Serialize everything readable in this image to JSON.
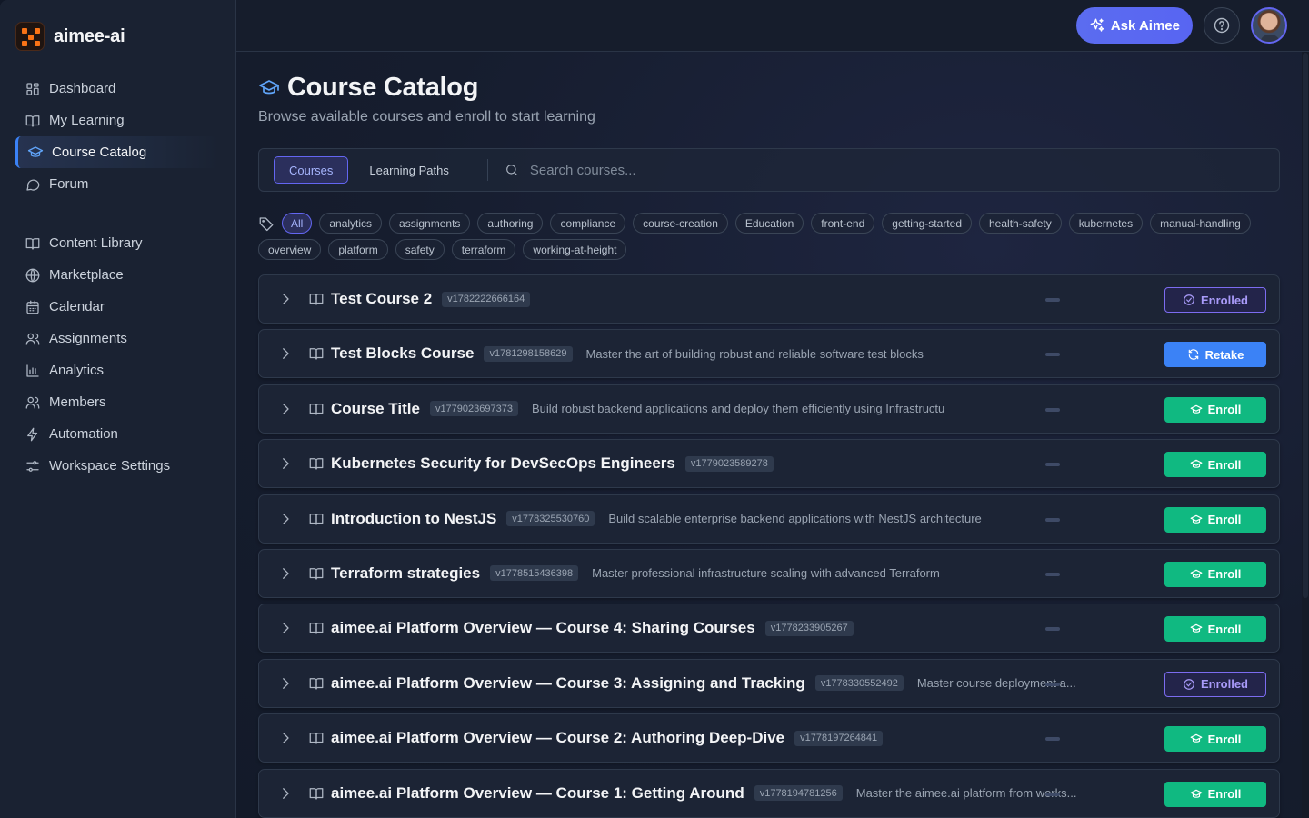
{
  "brand": {
    "name": "aimee-ai"
  },
  "nav_primary": [
    {
      "label": "Dashboard",
      "icon": "grid-icon"
    },
    {
      "label": "My Learning",
      "icon": "book-open-icon"
    },
    {
      "label": "Course Catalog",
      "icon": "graduation-cap-icon",
      "active": true
    },
    {
      "label": "Forum",
      "icon": "message-circle-icon"
    }
  ],
  "nav_secondary": [
    {
      "label": "Content Library",
      "icon": "book-open-icon"
    },
    {
      "label": "Marketplace",
      "icon": "globe-icon"
    },
    {
      "label": "Calendar",
      "icon": "calendar-icon"
    },
    {
      "label": "Assignments",
      "icon": "users-icon"
    },
    {
      "label": "Analytics",
      "icon": "bar-chart-icon"
    },
    {
      "label": "Members",
      "icon": "users-icon"
    },
    {
      "label": "Automation",
      "icon": "zap-icon"
    },
    {
      "label": "Workspace Settings",
      "icon": "sliders-icon"
    }
  ],
  "topbar": {
    "ask_label": "Ask Aimee"
  },
  "page": {
    "title": "Course Catalog",
    "subtitle": "Browse available courses and enroll to start learning"
  },
  "tabs": {
    "courses": "Courses",
    "paths": "Learning Paths"
  },
  "search": {
    "placeholder": "Search courses..."
  },
  "tags": [
    "All",
    "analytics",
    "assignments",
    "authoring",
    "compliance",
    "course-creation",
    "Education",
    "front-end",
    "getting-started",
    "health-safety",
    "kubernetes",
    "manual-handling",
    "overview",
    "platform",
    "safety",
    "terraform",
    "working-at-height"
  ],
  "courses": [
    {
      "title": "Test Course 2",
      "version": "v1782222666164",
      "desc": "",
      "action": "Enrolled",
      "kind": "enrolled"
    },
    {
      "title": "Test Blocks Course",
      "version": "v1781298158629",
      "desc": "Master the art of building robust and reliable software test blocks",
      "action": "Retake",
      "kind": "retake"
    },
    {
      "title": "Course Title",
      "version": "v1779023697373",
      "desc": "Build robust backend applications and deploy them efficiently using Infrastructu",
      "action": "Enroll",
      "kind": "enroll"
    },
    {
      "title": "Kubernetes Security for DevSecOps Engineers",
      "version": "v1779023589278",
      "desc": "",
      "action": "Enroll",
      "kind": "enroll"
    },
    {
      "title": "Introduction to NestJS",
      "version": "v1778325530760",
      "desc": "Build scalable enterprise backend applications with NestJS architecture",
      "action": "Enroll",
      "kind": "enroll"
    },
    {
      "title": "Terraform strategies",
      "version": "v1778515436398",
      "desc": "Master professional infrastructure scaling with advanced Terraform",
      "action": "Enroll",
      "kind": "enroll"
    },
    {
      "title": "aimee.ai Platform Overview — Course 4: Sharing Courses",
      "version": "v1778233905267",
      "desc": "",
      "action": "Enroll",
      "kind": "enroll"
    },
    {
      "title": "aimee.ai Platform Overview — Course 3: Assigning and Tracking",
      "version": "v1778330552492",
      "desc": "Master course deployment a...",
      "action": "Enrolled",
      "kind": "enrolled"
    },
    {
      "title": "aimee.ai Platform Overview — Course 2: Authoring Deep-Dive",
      "version": "v1778197264841",
      "desc": "",
      "action": "Enroll",
      "kind": "enroll"
    },
    {
      "title": "aimee.ai Platform Overview — Course 1: Getting Around",
      "version": "v1778194781256",
      "desc": "Master the aimee.ai platform from works...",
      "action": "Enroll",
      "kind": "enroll"
    }
  ]
}
